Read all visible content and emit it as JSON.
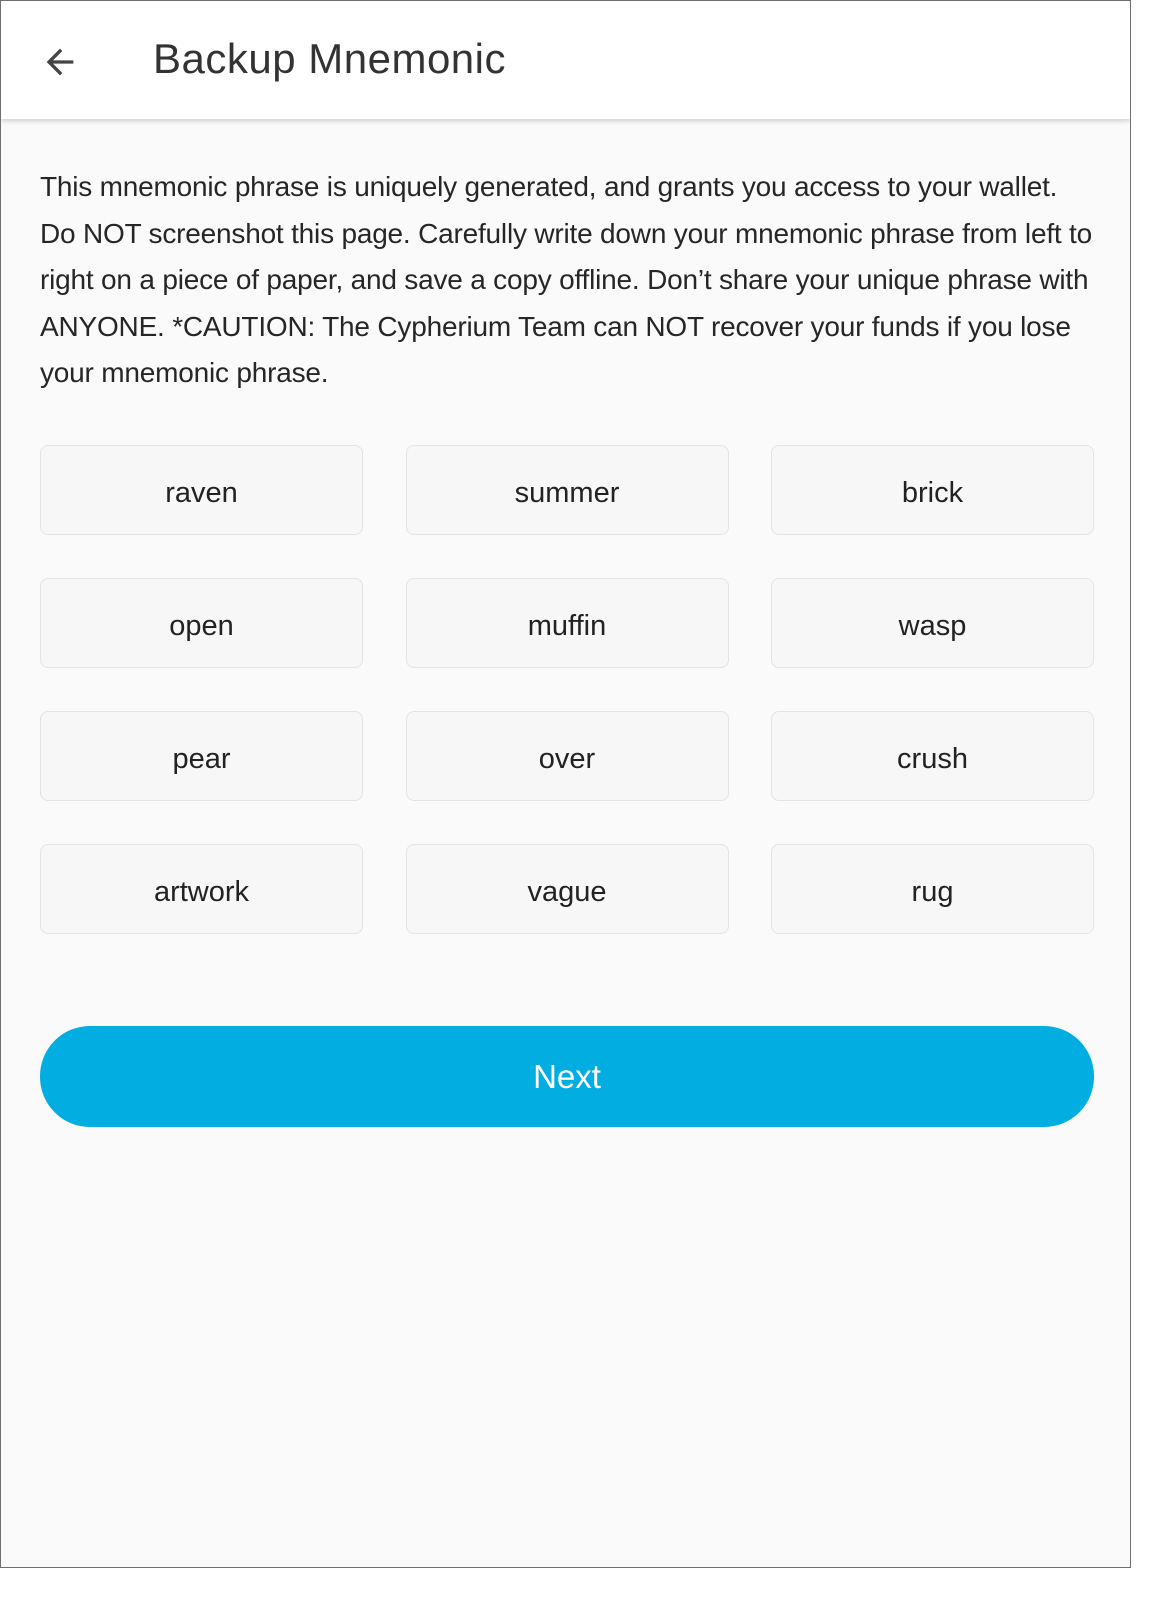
{
  "header": {
    "back_icon": "arrow-left-icon",
    "title": "Backup Mnemonic"
  },
  "intro_text": "This mnemonic phrase is uniquely generated, and grants you access to your wallet. Do NOT screenshot this page. Carefully write down your mnemonic phrase from left to right on a piece of paper, and save a copy offline. Don’t share your unique phrase with ANYONE. *CAUTION: The Cypherium Team can NOT recover your funds if you lose your mnemonic phrase.",
  "mnemonic_words": [
    "raven",
    "summer",
    "brick",
    "open",
    "muffin",
    "wasp",
    "pear",
    "over",
    "crush",
    "artwork",
    "vague",
    "rug"
  ],
  "next_button": {
    "label": "Next"
  },
  "colors": {
    "accent": "#02ade2",
    "background": "#fafafa",
    "header_bg": "#ffffff",
    "word_box_bg": "#f7f7f7",
    "word_box_border": "#e4e4e4"
  }
}
